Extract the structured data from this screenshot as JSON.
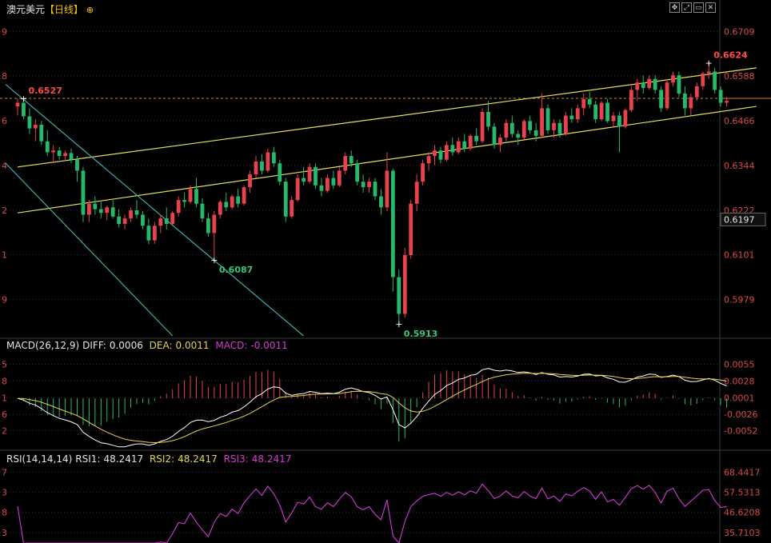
{
  "header": {
    "symbol": "澳元美元",
    "period": "【日线】",
    "toggle_icon": "circle-plus-icon",
    "window_buttons": [
      "move-icon",
      "expand-icon",
      "window-icon",
      "close-icon"
    ]
  },
  "colors": {
    "background": "#000000",
    "up": "#e8424a",
    "down": "#27b96a",
    "channel": "#e6e05a",
    "down_channel": "#3fa9b0",
    "price_axis_text": "#d84a4a",
    "grid": "#2a2a2a",
    "current_line": "#d9822b",
    "diff_line": "#ffffff",
    "dea_line": "#e6d44a",
    "rsi_line": "#d23cd2"
  },
  "chart_data": [
    {
      "type": "candlestick",
      "title": "澳元美元【日线】",
      "ylim": [
        0.588,
        0.676
      ],
      "y_ticks": [
        "0.6709",
        "0.6588",
        "0.6466",
        "0.6344",
        "0.6222",
        "0.6101",
        "0.5979"
      ],
      "left_ticks": [
        "9",
        "8",
        "6",
        "4",
        "2",
        "1",
        "9"
      ],
      "current_price": "0.6197",
      "reference_line": 0.6527,
      "annotations": [
        {
          "text": "0.6527",
          "kind": "high",
          "bar": 1
        },
        {
          "text": "0.6087",
          "kind": "low",
          "bar": 33
        },
        {
          "text": "0.5913",
          "kind": "low",
          "bar": 64
        },
        {
          "text": "0.6624",
          "kind": "high",
          "bar": 116
        }
      ],
      "candles": [
        [
          0.6505,
          0.6527,
          0.648,
          0.6515
        ],
        [
          0.6515,
          0.6527,
          0.647,
          0.6478
        ],
        [
          0.6478,
          0.65,
          0.643,
          0.6445
        ],
        [
          0.6445,
          0.647,
          0.641,
          0.6455
        ],
        [
          0.6455,
          0.6465,
          0.64,
          0.641
        ],
        [
          0.641,
          0.644,
          0.637,
          0.638
        ],
        [
          0.638,
          0.64,
          0.635,
          0.6385
        ],
        [
          0.6385,
          0.6395,
          0.636,
          0.637
        ],
        [
          0.637,
          0.6385,
          0.6355,
          0.6378
        ],
        [
          0.6378,
          0.639,
          0.635,
          0.636
        ],
        [
          0.636,
          0.637,
          0.63,
          0.633
        ],
        [
          0.633,
          0.634,
          0.619,
          0.621
        ],
        [
          0.621,
          0.625,
          0.619,
          0.624
        ],
        [
          0.624,
          0.626,
          0.621,
          0.6225
        ],
        [
          0.6225,
          0.6245,
          0.62,
          0.6215
        ],
        [
          0.6215,
          0.6235,
          0.6195,
          0.623
        ],
        [
          0.623,
          0.625,
          0.62,
          0.6205
        ],
        [
          0.6205,
          0.6225,
          0.6175,
          0.6185
        ],
        [
          0.6185,
          0.621,
          0.617,
          0.62
        ],
        [
          0.62,
          0.623,
          0.619,
          0.6222
        ],
        [
          0.6222,
          0.625,
          0.62,
          0.621
        ],
        [
          0.621,
          0.622,
          0.617,
          0.618
        ],
        [
          0.618,
          0.62,
          0.613,
          0.614
        ],
        [
          0.614,
          0.619,
          0.613,
          0.618
        ],
        [
          0.618,
          0.621,
          0.616,
          0.62
        ],
        [
          0.62,
          0.623,
          0.617,
          0.6185
        ],
        [
          0.6185,
          0.622,
          0.618,
          0.6215
        ],
        [
          0.6215,
          0.626,
          0.6205,
          0.625
        ],
        [
          0.625,
          0.627,
          0.623,
          0.6245
        ],
        [
          0.6245,
          0.629,
          0.624,
          0.628
        ],
        [
          0.628,
          0.631,
          0.623,
          0.624
        ],
        [
          0.624,
          0.6255,
          0.619,
          0.62
        ],
        [
          0.62,
          0.6215,
          0.615,
          0.616
        ],
        [
          0.616,
          0.622,
          0.6087,
          0.621
        ],
        [
          0.621,
          0.625,
          0.62,
          0.6245
        ],
        [
          0.6245,
          0.627,
          0.622,
          0.623
        ],
        [
          0.623,
          0.6265,
          0.6225,
          0.626
        ],
        [
          0.626,
          0.628,
          0.623,
          0.624
        ],
        [
          0.624,
          0.629,
          0.6235,
          0.6285
        ],
        [
          0.6285,
          0.633,
          0.627,
          0.632
        ],
        [
          0.632,
          0.637,
          0.631,
          0.6355
        ],
        [
          0.6355,
          0.6375,
          0.632,
          0.633
        ],
        [
          0.633,
          0.639,
          0.6325,
          0.638
        ],
        [
          0.638,
          0.6395,
          0.634,
          0.635
        ],
        [
          0.635,
          0.636,
          0.629,
          0.63
        ],
        [
          0.63,
          0.631,
          0.619,
          0.6205
        ],
        [
          0.6205,
          0.626,
          0.62,
          0.625
        ],
        [
          0.625,
          0.632,
          0.6245,
          0.631
        ],
        [
          0.631,
          0.634,
          0.629,
          0.63
        ],
        [
          0.63,
          0.635,
          0.6295,
          0.634
        ],
        [
          0.634,
          0.635,
          0.628,
          0.629
        ],
        [
          0.629,
          0.631,
          0.626,
          0.6275
        ],
        [
          0.6275,
          0.632,
          0.627,
          0.631
        ],
        [
          0.631,
          0.633,
          0.628,
          0.629
        ],
        [
          0.629,
          0.634,
          0.6285,
          0.633
        ],
        [
          0.633,
          0.638,
          0.632,
          0.637
        ],
        [
          0.637,
          0.6385,
          0.634,
          0.635
        ],
        [
          0.635,
          0.636,
          0.629,
          0.63
        ],
        [
          0.63,
          0.632,
          0.627,
          0.6285
        ],
        [
          0.6285,
          0.631,
          0.627,
          0.63
        ],
        [
          0.63,
          0.631,
          0.625,
          0.626
        ],
        [
          0.626,
          0.628,
          0.621,
          0.623
        ],
        [
          0.623,
          0.638,
          0.622,
          0.633
        ],
        [
          0.633,
          0.6335,
          0.6,
          0.604
        ],
        [
          0.604,
          0.606,
          0.5913,
          0.594
        ],
        [
          0.594,
          0.612,
          0.593,
          0.61
        ],
        [
          0.61,
          0.625,
          0.609,
          0.624
        ],
        [
          0.624,
          0.632,
          0.622,
          0.63
        ],
        [
          0.63,
          0.636,
          0.629,
          0.635
        ],
        [
          0.635,
          0.638,
          0.633,
          0.637
        ],
        [
          0.637,
          0.64,
          0.6345,
          0.6385
        ],
        [
          0.6385,
          0.6395,
          0.635,
          0.636
        ],
        [
          0.636,
          0.641,
          0.6355,
          0.64
        ],
        [
          0.64,
          0.642,
          0.637,
          0.638
        ],
        [
          0.638,
          0.642,
          0.6375,
          0.641
        ],
        [
          0.641,
          0.643,
          0.638,
          0.639
        ],
        [
          0.639,
          0.643,
          0.6385,
          0.6425
        ],
        [
          0.6425,
          0.6445,
          0.64,
          0.641
        ],
        [
          0.641,
          0.65,
          0.6405,
          0.649
        ],
        [
          0.649,
          0.652,
          0.644,
          0.645
        ],
        [
          0.645,
          0.646,
          0.639,
          0.64
        ],
        [
          0.64,
          0.643,
          0.638,
          0.642
        ],
        [
          0.642,
          0.647,
          0.641,
          0.646
        ],
        [
          0.646,
          0.648,
          0.642,
          0.643
        ],
        [
          0.643,
          0.644,
          0.64,
          0.642
        ],
        [
          0.642,
          0.647,
          0.6415,
          0.6465
        ],
        [
          0.6465,
          0.648,
          0.643,
          0.644
        ],
        [
          0.644,
          0.646,
          0.641,
          0.6425
        ],
        [
          0.6425,
          0.654,
          0.642,
          0.65
        ],
        [
          0.65,
          0.651,
          0.643,
          0.644
        ],
        [
          0.644,
          0.647,
          0.642,
          0.646
        ],
        [
          0.646,
          0.647,
          0.642,
          0.643
        ],
        [
          0.643,
          0.649,
          0.6425,
          0.648
        ],
        [
          0.648,
          0.65,
          0.646,
          0.647
        ],
        [
          0.647,
          0.651,
          0.646,
          0.65
        ],
        [
          0.65,
          0.654,
          0.648,
          0.6525
        ],
        [
          0.6525,
          0.6545,
          0.65,
          0.651
        ],
        [
          0.651,
          0.652,
          0.646,
          0.647
        ],
        [
          0.647,
          0.652,
          0.6465,
          0.6515
        ],
        [
          0.6515,
          0.6525,
          0.646,
          0.6465
        ],
        [
          0.6465,
          0.649,
          0.645,
          0.648
        ],
        [
          0.648,
          0.649,
          0.638,
          0.645
        ],
        [
          0.645,
          0.65,
          0.6445,
          0.6495
        ],
        [
          0.6495,
          0.656,
          0.649,
          0.655
        ],
        [
          0.655,
          0.658,
          0.652,
          0.657
        ],
        [
          0.657,
          0.659,
          0.654,
          0.6555
        ],
        [
          0.6555,
          0.659,
          0.655,
          0.658
        ],
        [
          0.658,
          0.659,
          0.654,
          0.655
        ],
        [
          0.655,
          0.656,
          0.649,
          0.65
        ],
        [
          0.65,
          0.658,
          0.6495,
          0.657
        ],
        [
          0.657,
          0.66,
          0.656,
          0.659
        ],
        [
          0.659,
          0.66,
          0.653,
          0.654
        ],
        [
          0.654,
          0.656,
          0.648,
          0.65
        ],
        [
          0.65,
          0.654,
          0.648,
          0.653
        ],
        [
          0.653,
          0.657,
          0.652,
          0.656
        ],
        [
          0.656,
          0.66,
          0.655,
          0.6595
        ],
        [
          0.6595,
          0.6624,
          0.658,
          0.66
        ],
        [
          0.66,
          0.661,
          0.654,
          0.655
        ],
        [
          0.655,
          0.656,
          0.6505,
          0.6515
        ],
        [
          0.6515,
          0.653,
          0.6505,
          0.652
        ]
      ]
    },
    {
      "type": "bar+line",
      "label": "MACD(26,12,9)",
      "legend": [
        {
          "name": "DIFF",
          "value": "0.0006"
        },
        {
          "name": "DEA",
          "value": "0.0011"
        },
        {
          "name": "MACD",
          "value": "-0.0011"
        }
      ],
      "ylim": [
        -0.008,
        0.0075
      ],
      "y_ticks": [
        "0.0055",
        "0.0028",
        "0.0001",
        "-0.0026",
        "-0.0052"
      ],
      "left_ticks": [
        "5",
        "8",
        "1",
        "6",
        "2"
      ]
    },
    {
      "type": "line",
      "label": "RSI(14,14,14)",
      "legend": [
        {
          "name": "RSI1",
          "value": "48.2417"
        },
        {
          "name": "RSI2",
          "value": "48.2417"
        },
        {
          "name": "RSI3",
          "value": "48.2417"
        }
      ],
      "ylim": [
        30.0,
        73.0
      ],
      "y_ticks": [
        "68.4417",
        "57.5313",
        "46.6208",
        "35.7103"
      ],
      "left_ticks": [
        "7",
        "3",
        "8",
        "3"
      ]
    }
  ]
}
